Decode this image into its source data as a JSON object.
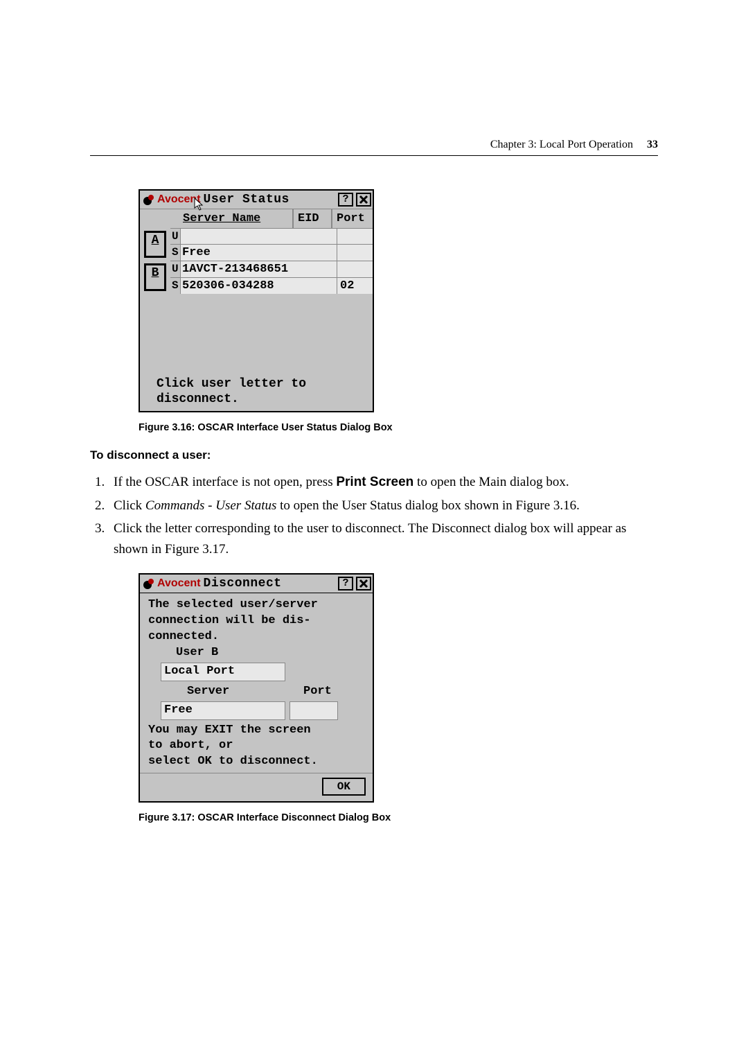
{
  "header": {
    "chapter": "Chapter 3: Local Port Operation",
    "page": "33"
  },
  "brand": "Avocent",
  "dlg1": {
    "title": "User Status",
    "help": "?",
    "cols": {
      "sn": "Server Name",
      "eid": "EID",
      "port": "Port"
    },
    "rows": [
      {
        "letter": "A",
        "u": "",
        "s": "Free",
        "port": ""
      },
      {
        "letter": "B",
        "u": "1AVCT-213468651",
        "s": "520306-034288",
        "port": "02"
      }
    ],
    "ulabel": "U",
    "slabel": "S",
    "foot1": "Click user letter to",
    "foot2": "disconnect."
  },
  "caption1": "Figure 3.16: OSCAR Interface User Status Dialog Box",
  "subhead": "To disconnect a user:",
  "steps": {
    "s1a": "If the OSCAR interface is not open, press ",
    "s1b": "Print Screen",
    "s1c": " to open the Main dialog box.",
    "s2a": "Click ",
    "s2b": "Commands - User Status",
    "s2c": " to open the User Status dialog box shown in Figure 3.16.",
    "s3": "Click the letter corresponding to the user to disconnect. The Disconnect dialog box will appear as shown in Figure 3.17."
  },
  "dlg2": {
    "title": "Disconnect",
    "help": "?",
    "l1": "The selected user/server",
    "l2": "connection will be dis-",
    "l3": "connected.",
    "userlabel": "User B",
    "userval": "Local Port",
    "srvlabel": "Server",
    "portlabel": "Port",
    "srvval": "Free",
    "portval": "",
    "l4": "You may EXIT the screen",
    "l5": "to abort, or",
    "l6": "select OK to disconnect.",
    "ok": "OK"
  },
  "caption2": "Figure 3.17: OSCAR Interface Disconnect Dialog Box"
}
